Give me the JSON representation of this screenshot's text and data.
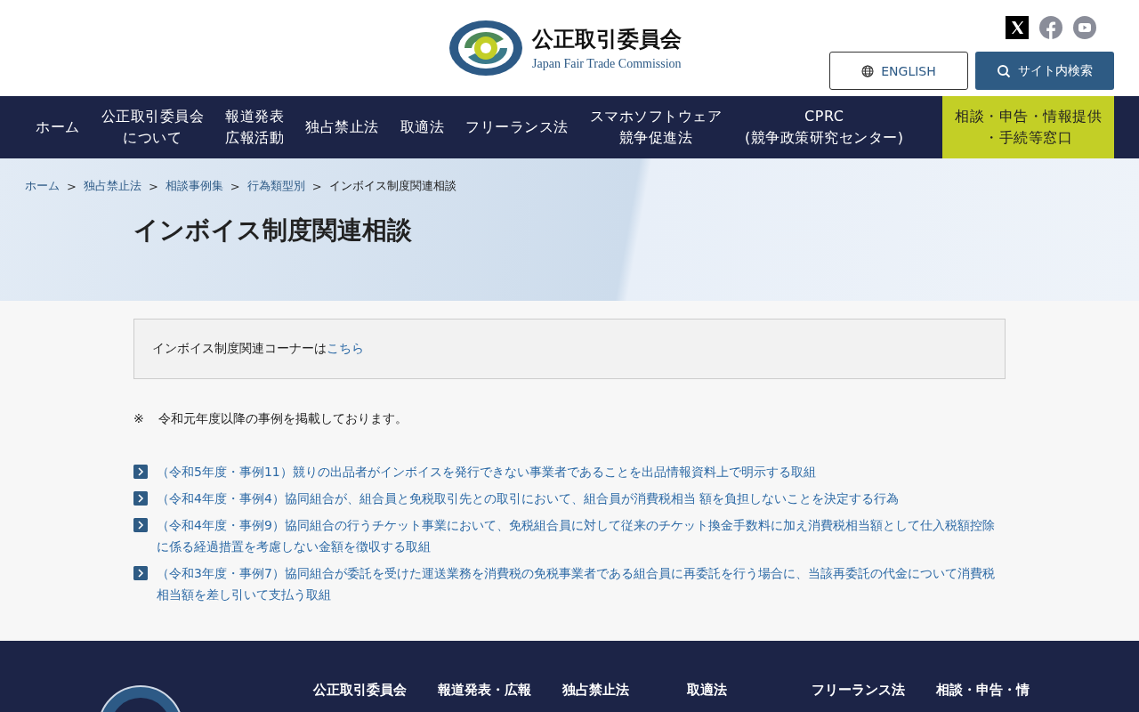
{
  "header": {
    "title": "公正取引委員会",
    "subtitle": "Japan Fair Trade Commission",
    "english_button": "ENGLISH",
    "search_button": "サイト内検索"
  },
  "nav": [
    {
      "lines": [
        "ホーム"
      ],
      "highlighted": false
    },
    {
      "lines": [
        "公正取引委員会",
        "について"
      ],
      "highlighted": false
    },
    {
      "lines": [
        "報道発表",
        "広報活動"
      ],
      "highlighted": false
    },
    {
      "lines": [
        "独占禁止法"
      ],
      "highlighted": false
    },
    {
      "lines": [
        "取適法"
      ],
      "highlighted": false
    },
    {
      "lines": [
        "フリーランス法"
      ],
      "highlighted": false
    },
    {
      "lines": [
        "スマホソフトウェア",
        "競争促進法"
      ],
      "highlighted": false
    },
    {
      "lines": [
        "CPRC",
        "(競争政策研究センター)"
      ],
      "highlighted": false
    },
    {
      "lines": [
        "相談・申告・情報提供",
        "・手続等窓口"
      ],
      "highlighted": true
    }
  ],
  "breadcrumb_separator": ">",
  "breadcrumb": [
    "ホーム",
    "独占禁止法",
    "相談事例集",
    "行為類型別",
    "インボイス制度関連相談"
  ],
  "page_title": "インボイス制度関連相談",
  "notice": {
    "text": "インボイス制度関連コーナーは",
    "link": "こちら"
  },
  "note": {
    "mark": "※",
    "text": "令和元年度以降の事例を掲載しております。"
  },
  "cases": [
    "（令和5年度・事例11）競りの出品者がインボイスを発行できない事業者であることを出品情報資料上で明示する取組",
    "（令和4年度・事例4）協同組合が、組合員と免税取引先との取引において、組合員が消費税相当 額を負担しないことを決定する行為",
    "（令和4年度・事例9）協同組合の行うチケット事業において、免税組合員に対して従来のチケット換金手数料に加え消費税相当額として仕入税額控除に係る経過措置を考慮しない金額を徴収する取組",
    "（令和3年度・事例7）協同組合が委託を受けた運送業務を消費税の免税事業者である組合員に再委託を行う場合に、当該再委託の代金について消費税相当額を差し引いて支払う取組"
  ],
  "footer_nav": [
    "公正取引委員会",
    "報道発表・広報",
    "独占禁止法",
    "取適法",
    "フリーランス法",
    "相談・申告・情"
  ]
}
